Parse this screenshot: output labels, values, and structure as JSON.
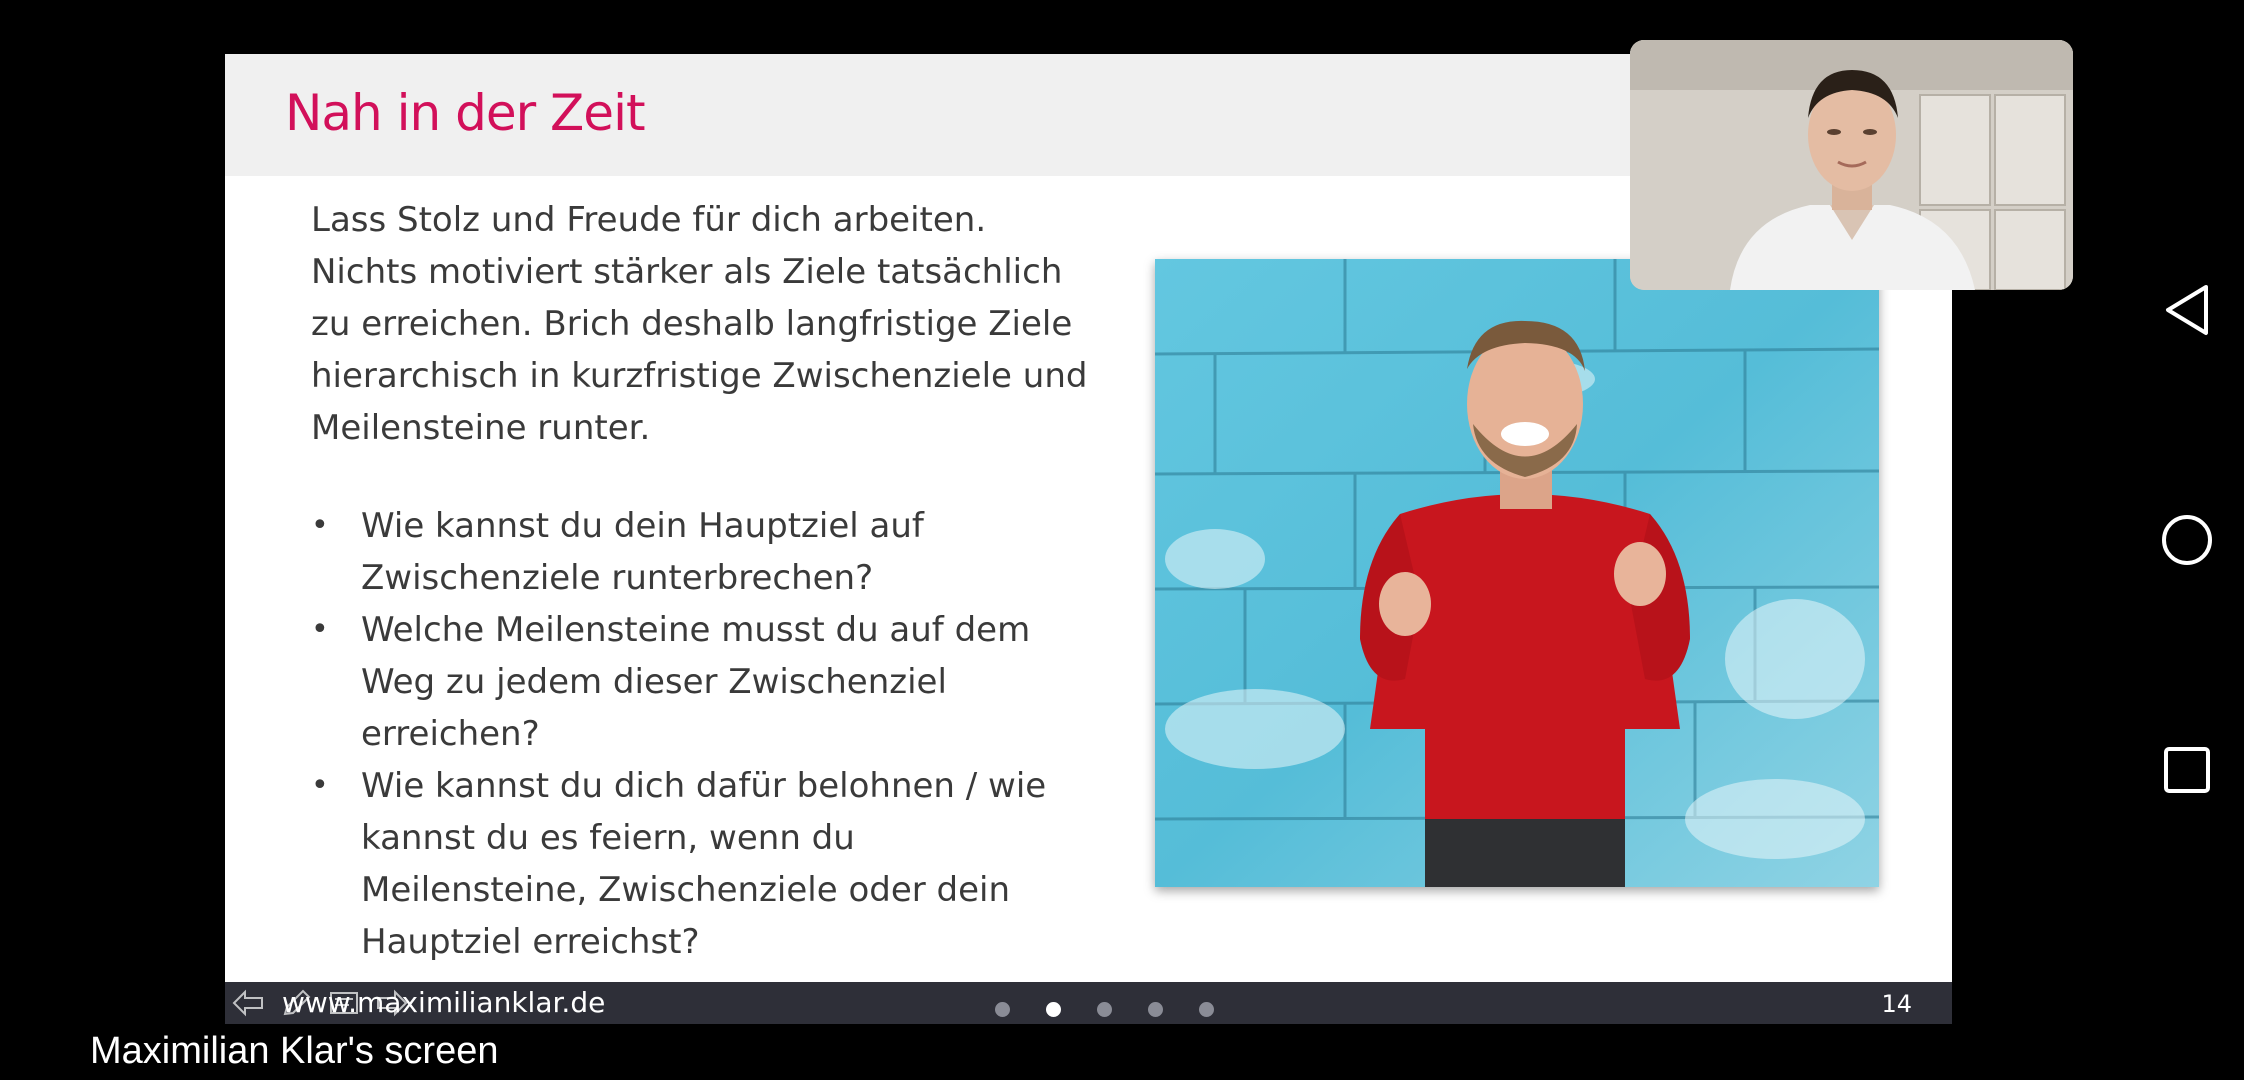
{
  "slide": {
    "title": "Nah in der Zeit",
    "intro_lines": [
      "Lass Stolz und Freude für dich arbeiten.",
      "Nichts motiviert stärker als Ziele tatsächlich",
      "zu erreichen. Brich deshalb langfristige Ziele",
      "hierarchisch in kurzfristige Zwischenziele und",
      "Meilensteine runter."
    ],
    "bullets": [
      {
        "lines": [
          "Wie kannst du dein Hauptziel auf",
          "Zwischenziele runterbrechen?"
        ]
      },
      {
        "lines": [
          "Welche Meilensteine musst du auf dem",
          "Weg zu jedem dieser Zwischenziel",
          "erreichen?"
        ]
      },
      {
        "lines": [
          "Wie kannst du dich dafür belohnen / wie",
          "kannst du es feiern, wenn du",
          "Meilensteine, Zwischenziele oder dein",
          "Hauptziel erreichst?"
        ]
      }
    ],
    "bullet_char": "•",
    "footer_url": "www.maximilianklar.de",
    "page_number": "14",
    "pagination": {
      "total": 5,
      "active_index": 1
    },
    "photo_icon": "man-celebrating-photo",
    "controls": [
      "back-arrow-icon",
      "pen-icon",
      "notes-icon",
      "forward-arrow-icon"
    ]
  },
  "webcam": {
    "icon": "presenter-video-feed"
  },
  "caption": "Maximilian Klar's screen",
  "nav": {
    "back_icon": "back-triangle-icon",
    "home_icon": "home-circle-icon",
    "recents_icon": "recents-square-icon"
  },
  "colors": {
    "title": "#d2105a",
    "footer_bg": "#2e2f38",
    "body_text": "#3a3a3a",
    "wall_blue": "#5bc4de",
    "sweater_red": "#c8161e"
  }
}
